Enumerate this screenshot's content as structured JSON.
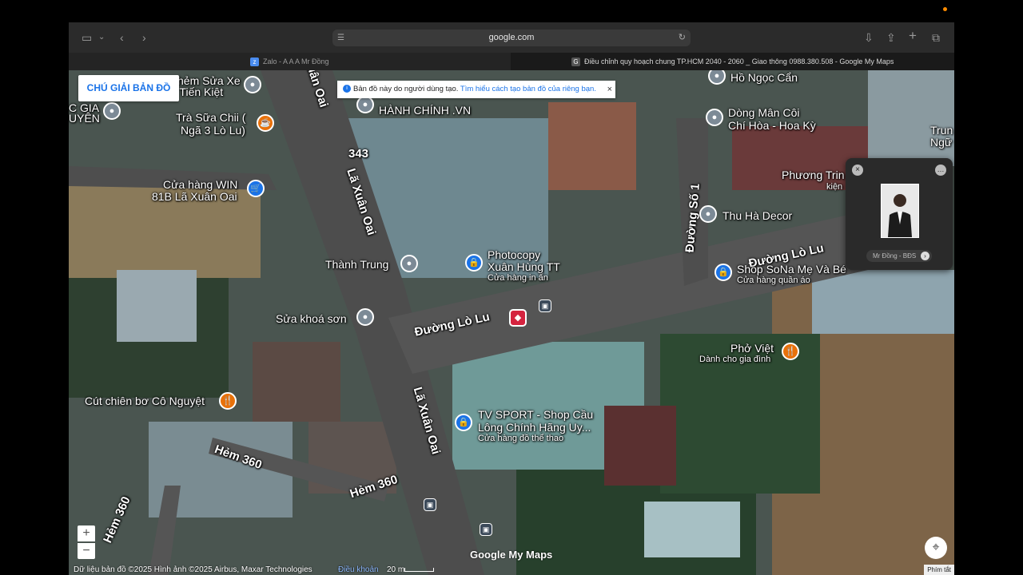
{
  "browser": {
    "url": "google.com",
    "tabs": [
      {
        "label": "Zalo - A A A Mr Đồng",
        "favicon": "zalo-icon"
      },
      {
        "label": "Điều chỉnh quy hoạch chung TP.HCM 2040 - 2060 _ Giao thông 0988.380.508 - Google My Maps",
        "favicon": "G"
      }
    ]
  },
  "map": {
    "legend_button": "CHÚ GIẢI BẢN ĐỒ",
    "notice": {
      "text": "Bản đồ này do người dùng tạo.",
      "link": "Tìm hiểu cách tạo bản đồ của riêng bạn."
    },
    "roads": [
      {
        "label": "Lã Xuân Oai"
      },
      {
        "label": "Lã Xuân Oai"
      },
      {
        "label": "uân Oai"
      },
      {
        "label": "Đường Lò Lu"
      },
      {
        "label": "Đường Lò Lu"
      },
      {
        "label": "Đường Số 1"
      },
      {
        "label": "Hẻm 360"
      },
      {
        "label": "Hẻm 360"
      },
      {
        "label": "Hẻm 360"
      },
      {
        "label": "343"
      }
    ],
    "places": [
      {
        "name": "hẻm Sửa Xe",
        "sub": ""
      },
      {
        "name": "a Tiến Kiệt",
        "sub": ""
      },
      {
        "name": "Trà Sữa Chii (",
        "sub": "Ngã 3 Lò Lu)"
      },
      {
        "name": "Cửa hàng WIN",
        "sub": "81B Lã Xuân Oai"
      },
      {
        "name": "Thành Trung",
        "sub": ""
      },
      {
        "name": "Sửa khoá sơn",
        "sub": ""
      },
      {
        "name": "Cút chiên bơ Cô Nguyệt",
        "sub": ""
      },
      {
        "name": "Photocopy",
        "sub": "Xuân Hùng TT"
      },
      {
        "name": "Cửa hàng in ấn",
        "sub": ""
      },
      {
        "name": "HÀNH CHÍNH .VN",
        "sub": ""
      },
      {
        "name": "Hồ Ngọc Cẩn",
        "sub": ""
      },
      {
        "name": "Dòng Mân Côi",
        "sub": "Chí Hòa - Hoa Kỳ"
      },
      {
        "name": "Phương Trin",
        "sub": "kiện"
      },
      {
        "name": "Thu Hà Decor",
        "sub": ""
      },
      {
        "name": "Shop SoNa Mẹ Và Bé",
        "sub": "Cửa hàng quần áo"
      },
      {
        "name": "Phở Việt",
        "sub": "Dành cho gia đình"
      },
      {
        "name": "TV SPORT - Shop Cầu",
        "sub": "Lông Chính Hãng Uy..."
      },
      {
        "name": "Cửa hàng đồ thể thao",
        "sub": ""
      },
      {
        "name": "Trun",
        "sub": "Ngữ E"
      },
      {
        "name": "C GIA",
        "sub": "UYÊN"
      }
    ],
    "card_caption": "Mr Đồng - BĐS",
    "attribution": "Dữ liệu bản đồ ©2025 Hình ảnh ©2025 Airbus, Maxar Technologies",
    "terms": "Điều khoản",
    "scale": "20 m",
    "shortcut": "Phím tắt",
    "brand": "Google My Maps",
    "zoom_in": "+",
    "zoom_out": "−"
  }
}
